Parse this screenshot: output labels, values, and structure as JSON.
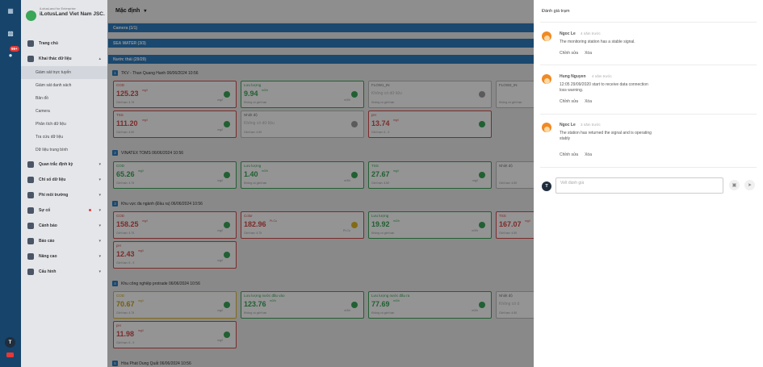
{
  "rail": {
    "badge": "99+",
    "user_initial": "T"
  },
  "brand": {
    "sub": "iLotusLand for Enterprise",
    "name": "iLotusLand Viet Nam JSC."
  },
  "sidebar": {
    "items": [
      {
        "label": "Trang chủ",
        "icon": "home-icon"
      },
      {
        "label": "Khai thác dữ liệu",
        "icon": "database-icon"
      },
      {
        "label": "Quan trắc định kỳ",
        "icon": "calendar-icon"
      },
      {
        "label": "Chỉ số dữ liệu",
        "icon": "index-icon"
      },
      {
        "label": "Phí môi trường",
        "icon": "fee-icon"
      },
      {
        "label": "Sự cố",
        "icon": "incident-icon"
      },
      {
        "label": "Cảnh báo",
        "icon": "bell-icon"
      },
      {
        "label": "Báo cáo",
        "icon": "report-icon"
      },
      {
        "label": "Nâng cao",
        "icon": "advanced-icon"
      },
      {
        "label": "Cấu hình",
        "icon": "config-icon"
      }
    ],
    "sub_items": [
      "Giám sát trực tuyến",
      "Giám sát danh sách",
      "Bản đồ",
      "Camera",
      "Phân tích dữ liệu",
      "Tra cứu dữ liệu",
      "Dữ liệu trung bình"
    ]
  },
  "main": {
    "view_selector": "Mặc định",
    "groups": [
      "Camera (1/1)",
      "SEA WATER (3/3)",
      "Nước thải (29/29)"
    ],
    "stations": [
      {
        "num": "1",
        "title": "TKV - Than Quang Hanh",
        "time": "06/06/2024 10:56"
      },
      {
        "num": "2",
        "title": "VINATEX TOMS",
        "time": "06/06/2024 10:56"
      },
      {
        "num": "3",
        "title": "Khu vực đa ngành (Đầu ra)",
        "time": "06/06/2024 10:56"
      },
      {
        "num": "4",
        "title": "Khu công nghiệp protrade",
        "time": "06/06/2024 10:56"
      },
      {
        "num": "5",
        "title": "Hòa Phát Dung Quất",
        "time": "06/06/2024 10:56"
      }
    ],
    "cards": [
      {
        "label": "COD",
        "value": "125.23",
        "unit": "mg/l",
        "limit": "Giới hạn: 4.75",
        "time": "mg/l",
        "color": "red",
        "status": "g"
      },
      {
        "label": "Lưu lượng",
        "value": "9.94",
        "unit": "m3/h",
        "limit": "Không có giới hạn",
        "time": "m3/h",
        "color": "green",
        "status": "g"
      },
      {
        "label": "FLOW1_IN",
        "value": "",
        "nodata": "Không có dữ liệu",
        "unit": "",
        "limit": "Không có giới hạn",
        "time": "",
        "color": "gray",
        "status": "gr"
      },
      {
        "label": "FLOW2_IN",
        "value": "",
        "nodata": "",
        "unit": "",
        "limit": "Không có giới hạn",
        "time": "",
        "color": "gray",
        "status": ""
      },
      {
        "label": "TSS",
        "value": "111.20",
        "unit": "mg/l",
        "limit": "Giới hạn: 4.50",
        "time": "mg/l",
        "color": "red",
        "status": "g"
      },
      {
        "label": "Nhiệt độ",
        "value": "",
        "nodata": "Không có dữ liệu",
        "unit": "",
        "limit": "Giới hạn: 4.50",
        "time": "",
        "color": "gray",
        "status": "gr"
      },
      {
        "label": "pH",
        "value": "13.74",
        "unit": "mg/l",
        "limit": "Giới hạn: 6 - 9",
        "time": "",
        "color": "red",
        "status": "g"
      },
      {
        "label": "COD",
        "value": "65.26",
        "unit": "mg/l",
        "limit": "Giới hạn: 4.75",
        "time": "mg/l",
        "color": "green",
        "status": "g"
      },
      {
        "label": "Lưu lượng",
        "value": "1.40",
        "unit": "m3/h",
        "limit": "Không có giới hạn",
        "time": "m3/h",
        "color": "green",
        "status": "g"
      },
      {
        "label": "TSS",
        "value": "27.67",
        "unit": "mg/l",
        "limit": "Giới hạn: 4.50",
        "time": "mg/l",
        "color": "green",
        "status": "g"
      },
      {
        "label": "Nhiệt độ",
        "value": "",
        "nodata": "",
        "unit": "",
        "limit": "Giới hạn: 4.50",
        "time": "",
        "color": "gray",
        "status": ""
      },
      {
        "label": "COD",
        "value": "158.25",
        "unit": "mg/l",
        "limit": "Giới hạn: 4.75",
        "time": "mg/l",
        "color": "red",
        "status": "g"
      },
      {
        "label": "Color",
        "value": "182.96",
        "unit": "Pt-Co",
        "limit": "Giới hạn: 4.75",
        "time": "Pt-Co",
        "color": "red",
        "status": "y"
      },
      {
        "label": "Lưu lượng",
        "value": "19.92",
        "unit": "m3/h",
        "limit": "Không có giới hạn",
        "time": "m3/h",
        "color": "green",
        "status": "g"
      },
      {
        "label": "TSS",
        "value": "167.07",
        "unit": "mg/l",
        "limit": "Giới hạn: 4.50",
        "time": "",
        "color": "red",
        "status": ""
      },
      {
        "label": "pH",
        "value": "12.43",
        "unit": "mg/l",
        "limit": "Giới hạn: 6 - 9",
        "time": "mg/l",
        "color": "red",
        "status": "g"
      },
      {
        "label": "COD",
        "value": "70.67",
        "unit": "mg/l",
        "limit": "Giới hạn: 4.75",
        "time": "mg/l",
        "color": "yellow",
        "status": "g"
      },
      {
        "label": "Lưu lượng nước đầu vào",
        "value": "123.76",
        "unit": "m3/h",
        "limit": "Không có giới hạn",
        "time": "m3/h",
        "color": "green",
        "status": "g"
      },
      {
        "label": "Lưu lượng nước đầu ra",
        "value": "77.69",
        "unit": "m3/h",
        "limit": "Không có giới hạn",
        "time": "m3/h",
        "color": "green",
        "status": "g"
      },
      {
        "label": "Nhiệt độ",
        "value": "",
        "nodata": "Không có d",
        "unit": "",
        "limit": "Giới hạn: 4.50",
        "time": "",
        "color": "gray",
        "status": ""
      },
      {
        "label": "pH",
        "value": "11.98",
        "unit": "mg/l",
        "limit": "Giới hạn: 6 - 9",
        "time": "mg/l",
        "color": "red",
        "status": "g"
      }
    ]
  },
  "drawer": {
    "title": "Đánh giá trạm",
    "comments": [
      {
        "author": "Ngoc Le",
        "time": "4 năm trước",
        "text": "The monitoring station has a stable signal.",
        "edit": "Chỉnh sửa",
        "delete": "Xóa"
      },
      {
        "author": "Hung Nguyen",
        "time": "4 năm trước",
        "text": "12:05 29/09/2020 start to receive data connection loss warning.",
        "edit": "Chỉnh sửa",
        "delete": "Xóa"
      },
      {
        "author": "Ngoc Le",
        "time": "3 năm trước",
        "text": "The station has returned the signal and is operating stably",
        "edit": "Chỉnh sửa",
        "delete": "Xóa"
      }
    ],
    "composer_initial": "T",
    "composer_placeholder": "Viết đánh giá"
  },
  "colors": {
    "primary": "#2e7cc0",
    "good": "#3aa657",
    "exceed": "#d84a4a",
    "warning": "#e0b829",
    "rail": "#17446b"
  }
}
